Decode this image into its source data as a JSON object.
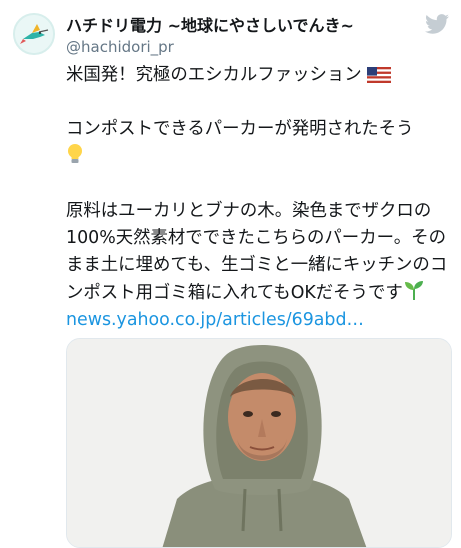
{
  "tweet": {
    "display_name": "ハチドリ電力 ~地球にやさしいでんき~",
    "handle": "@hachidori_pr",
    "line1": "米国発！究極のエシカルファッション",
    "line2": "コンポストできるパーカーが発明されたそう",
    "line3": "原料はユーカリとブナの木。染色までザクロの100%天然素材でできたこちらのパーカー。そのまま土に埋めても、生ゴミと一緒にキッチンのコンポスト用ゴミ箱に入れてもOKだそうです",
    "link_text": "news.yahoo.co.jp/articles/69abd…"
  },
  "icons": {
    "brand": "twitter-bird-icon",
    "flag": "us-flag-emoji",
    "bulb": "light-bulb-emoji",
    "sprout": "seedling-emoji"
  },
  "colors": {
    "link": "#1b95e0",
    "handle": "#657786",
    "twitter": "#c5cdd3"
  }
}
